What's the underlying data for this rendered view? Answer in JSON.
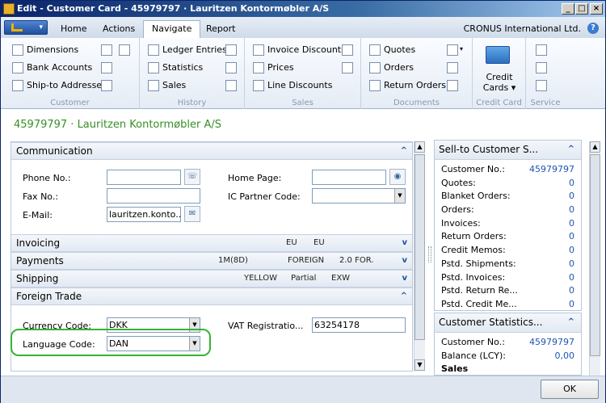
{
  "window": {
    "title": "Edit - Customer Card - 45979797 · Lauritzen Kontormøbler A/S"
  },
  "tabs": [
    "Home",
    "Actions",
    "Navigate",
    "Report"
  ],
  "active_tab": "Navigate",
  "company": "CRONUS International Ltd.",
  "ribbon": {
    "customer": {
      "label": "Customer",
      "items": [
        "Dimensions",
        "Bank Accounts",
        "Ship-to Addresses"
      ]
    },
    "history": {
      "label": "History",
      "items": [
        "Ledger Entries",
        "Statistics",
        "Sales"
      ]
    },
    "sales": {
      "label": "Sales",
      "items": [
        "Invoice Discounts",
        "Prices",
        "Line Discounts"
      ]
    },
    "documents": {
      "label": "Documents",
      "items": [
        "Quotes",
        "Orders",
        "Return Orders"
      ]
    },
    "credit_card": {
      "label": "Credit Card",
      "button_line1": "Credit",
      "button_line2": "Cards ▾"
    },
    "service": {
      "label": "Service"
    }
  },
  "page_title": "45979797 · Lauritzen Kontormøbler A/S",
  "communication": {
    "header": "Communication",
    "phone_label": "Phone No.:",
    "phone_value": "",
    "fax_label": "Fax No.:",
    "fax_value": "",
    "email_label": "E-Mail:",
    "email_value": "lauritzen.konto...",
    "homepage_label": "Home Page:",
    "homepage_value": "",
    "ic_partner_label": "IC Partner Code:",
    "ic_partner_value": ""
  },
  "invoicing": {
    "header": "Invoicing",
    "summary": [
      "EU",
      "EU"
    ]
  },
  "payments": {
    "header": "Payments",
    "summary": [
      "1M(8D)",
      "FOREIGN",
      "2.0 FOR."
    ]
  },
  "shipping": {
    "header": "Shipping",
    "summary": [
      "YELLOW",
      "Partial",
      "EXW"
    ]
  },
  "foreign_trade": {
    "header": "Foreign Trade",
    "currency_label": "Currency Code:",
    "currency_value": "DKK",
    "language_label": "Language Code:",
    "language_value": "DAN",
    "vat_label": "VAT Registratio...",
    "vat_value": "63254178"
  },
  "factbox_sell_to": {
    "header": "Sell-to Customer S...",
    "rows": [
      {
        "label": "Customer No.:",
        "value": "45979797"
      },
      {
        "label": "Quotes:",
        "value": "0"
      },
      {
        "label": "Blanket Orders:",
        "value": "0"
      },
      {
        "label": "Orders:",
        "value": "0"
      },
      {
        "label": "Invoices:",
        "value": "0"
      },
      {
        "label": "Return Orders:",
        "value": "0"
      },
      {
        "label": "Credit Memos:",
        "value": "0"
      },
      {
        "label": "Pstd. Shipments:",
        "value": "0"
      },
      {
        "label": "Pstd. Invoices:",
        "value": "0"
      },
      {
        "label": "Pstd. Return Re...",
        "value": "0"
      },
      {
        "label": "Pstd. Credit Me...",
        "value": "0"
      }
    ]
  },
  "factbox_stats": {
    "header": "Customer Statistics...",
    "rows": [
      {
        "label": "Customer No.:",
        "value": "45979797"
      },
      {
        "label": "Balance (LCY):",
        "value": "0,00"
      }
    ],
    "partial": "Sales"
  },
  "footer": {
    "ok_label": "OK"
  }
}
